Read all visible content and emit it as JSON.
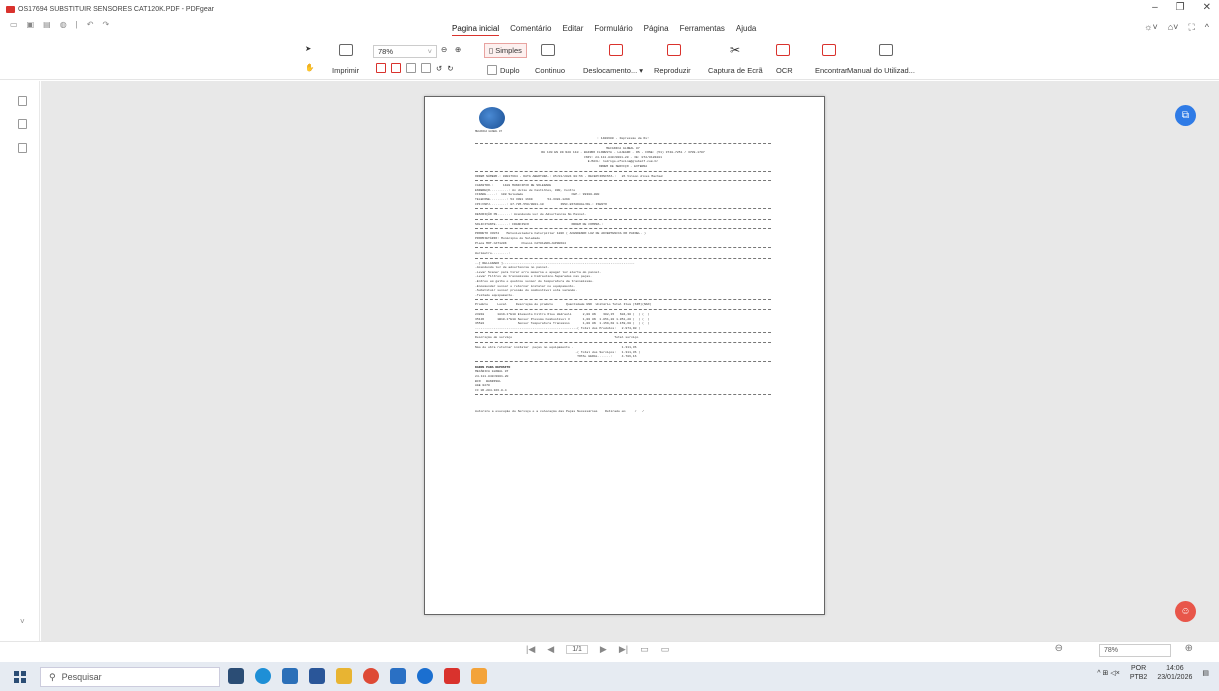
{
  "window": {
    "title": "OS17694 SUBSTITUIR SENSORES CAT120K.PDF - PDFgear"
  },
  "menu": {
    "tabs": [
      "Pagina inicial",
      "Comentário",
      "Editar",
      "Formulário",
      "Página",
      "Ferramentas",
      "Ajuda"
    ]
  },
  "toolbar": {
    "print": "Imprimir",
    "zoom_value": "78%",
    "simples": "Simples",
    "duplo": "Duplo",
    "continuo": "Continuo",
    "deslocamento": "Deslocamento... ▾",
    "reproduzir": "Reproduzir",
    "captura": "Captura de Ecrã",
    "ocr": "OCR",
    "encontrar": "Encontrar",
    "manual": "Manual do Utilizad..."
  },
  "document": {
    "lines": [
      ": 1400600 - Impressão da Os!",
      "MECANICA GLOBAL 07",
      "RU 130 EN 09 N20 110 - BAIRRO FLORESTA - LAJEADO - RS - FONE: (51) 3748-7251 / 3709-1707",
      "CNPJ: 24.111.840/0001-20 - IE: 072/0183281",
      "E-MAIL: rodrigo.oficina@global7.com.br",
      "ORDEM DE SERVIÇO - EXTERNA",
      "ORDEM NÚMERO.: 00017694 - DATA ABERTURA.: 05/01/2024 08:56 - RECEPCIONISTA.:   26 Vilson Alves Machad",
      "CADASTRO.:     1108 MUNICIPIO DE SOLEDADE",
      "ENDEREÇO..........: Av Julio de Castilhos, 000, Centro",
      "CIDADE.....:  108 Soledade                          CEP.: 99300-000",
      "TELEFONE.........: 54 3381 1699        54-3381-1299",
      "CPF/CNPJ.........: 87.785.550/0001-10         INSC.ESTADUAL/RG.: ISENTO",
      "DESCRIÇÃO OS.......: Acendendo Luz de Advertencia No Painel.",
      "SOLICITANTE.......: FRANCISCO                       ORDEM DE COMPRA.:",
      "PRODUTO 33074    Motoniveladora Caterpillar 120K ( ACENDENDO LUZ DE ADVERTENCIA NO PAINEL. )",
      "PROPRIETÁRIO: Municipio de Soledade",
      "Placa MOT.CAT120K        Chassi CAT0120KLJAP00684",
      "Horimetro.........:",
      "--[ RELLANADO ]-----------------------------------------------------------------------",
      "-Acendendo luz de advertencia no painel.",
      "-Levar Scaner para tirar erro memoria e apagar luz alerta do painel.",
      "-Levar filtros de transmissão e hidraulico.Separados nas peças.",
      "-Entrou em galho e quebrou sensor de temperatura da transmissão.",
      "-Encomendar sensor e retornar instalar no equipamento.",
      "-Substituir sensor pressão do combustivel esta vazando.",
      "-Testado equipamento.",
      "Produto     Local     Descrição do produto       Quantidade UND  Unitário Total Item (SIM)(NAO)",
      "23818       1A19-1*E18 Elemento Filtro Oleo Hidrauli      2,00 UN    302,15   604,30 (  ) (  )",
      "35136       1B10-1*E18 Sensor Pressão Combustivel 3       1,00 UN  1.051,20 1.051,20 (  ) (  )",
      "35522                  Sensor Temperatura Transmiss       1,00 UN  1.159,60 1.159,60 (  ) (  )",
      "-------------------------------------------------------( Total dos Produtos:   2.974,90 )",
      "Descrição do serviço                                                       Total serviço",
      "Não de obra retornar instalar  peças no equipamento .                          1.311,36",
      "                                                      -( Total dos Serviços:   1.311,36 )",
      "                                                       TOTAL GERAL.......:     4.786,16",
      "DADOS PARA DEPOSITO",
      "MECÂNICA GLOBAL 07",
      "24.111.840/0001-20",
      "BCO   BANRISUL",
      "AGE 0270",
      "CC 06.204.166.0-4",
      "Autorizo a execução do Serviço e a colocação das Peças Necessárias    Retirado em     /   /"
    ]
  },
  "navigation": {
    "page_indicator": "1/1",
    "zoom_bottom": "78%"
  },
  "taskbar": {
    "search_placeholder": "Pesquisar",
    "lang_top": "POR",
    "lang_bottom": "PTB2",
    "time": "14:06",
    "date": "23/01/2026"
  }
}
